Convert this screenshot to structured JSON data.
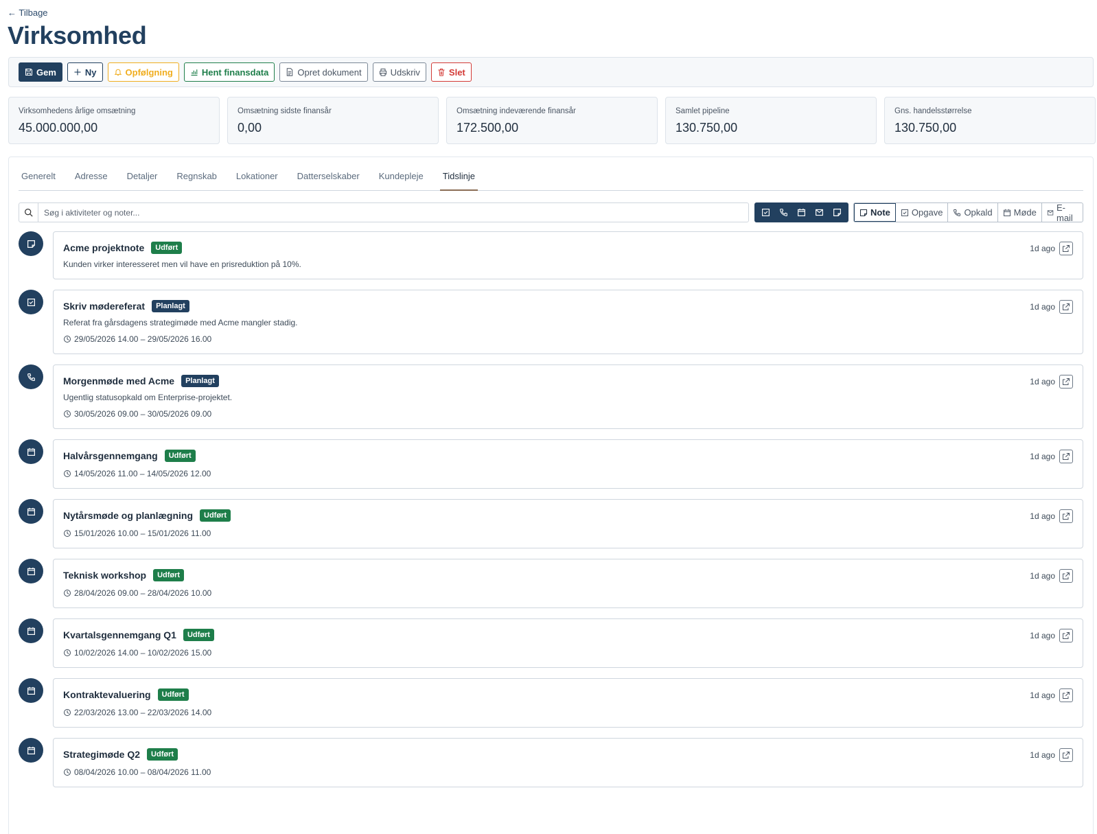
{
  "nav": {
    "back_label": "← Tilbage"
  },
  "page": {
    "title": "Virksomhed"
  },
  "toolbar": {
    "save": "Gem",
    "new": "Ny",
    "followup": "Opfølgning",
    "fetch_finance": "Hent finansdata",
    "create_doc": "Opret dokument",
    "print": "Udskriv",
    "delete": "Slet"
  },
  "stats": [
    {
      "label": "Virksomhedens årlige omsætning",
      "value": "45.000.000,00"
    },
    {
      "label": "Omsætning sidste finansår",
      "value": "0,00"
    },
    {
      "label": "Omsætning indeværende finansår",
      "value": "172.500,00"
    },
    {
      "label": "Samlet pipeline",
      "value": "130.750,00"
    },
    {
      "label": "Gns. handelsstørrelse",
      "value": "130.750,00"
    }
  ],
  "tabs": [
    "Generelt",
    "Adresse",
    "Detaljer",
    "Regnskab",
    "Lokationer",
    "Datterselskaber",
    "Kundepleje",
    "Tidslinje"
  ],
  "active_tab": "Tidslinje",
  "search": {
    "placeholder": "Søg i aktiviteter og noter..."
  },
  "filter_icons": [
    "task-icon",
    "phone-icon",
    "calendar-icon",
    "mail-icon",
    "note-icon"
  ],
  "new_buttons": [
    "Note",
    "Opgave",
    "Opkald",
    "Møde",
    "E-mail"
  ],
  "timeline": [
    {
      "type": "note",
      "title": "Acme projektnote",
      "status": "Udført",
      "status_kind": "done",
      "desc": "Kunden virker interesseret men vil have en prisreduktion på 10%.",
      "time": "",
      "ago": "1d ago"
    },
    {
      "type": "task",
      "title": "Skriv mødereferat",
      "status": "Planlagt",
      "status_kind": "planned",
      "desc": "Referat fra gårsdagens strategimøde med Acme mangler stadig.",
      "time": "29/05/2026 14.00 – 29/05/2026 16.00",
      "ago": "1d ago"
    },
    {
      "type": "call",
      "title": "Morgenmøde med Acme",
      "status": "Planlagt",
      "status_kind": "planned",
      "desc": "Ugentlig statusopkald om Enterprise-projektet.",
      "time": "30/05/2026 09.00 – 30/05/2026 09.00",
      "ago": "1d ago"
    },
    {
      "type": "meeting",
      "title": "Halvårsgennemgang",
      "status": "Udført",
      "status_kind": "done",
      "desc": "",
      "time": "14/05/2026 11.00 – 14/05/2026 12.00",
      "ago": "1d ago"
    },
    {
      "type": "meeting",
      "title": "Nytårsmøde og planlægning",
      "status": "Udført",
      "status_kind": "done",
      "desc": "",
      "time": "15/01/2026 10.00 – 15/01/2026 11.00",
      "ago": "1d ago"
    },
    {
      "type": "meeting",
      "title": "Teknisk workshop",
      "status": "Udført",
      "status_kind": "done",
      "desc": "",
      "time": "28/04/2026 09.00 – 28/04/2026 10.00",
      "ago": "1d ago"
    },
    {
      "type": "meeting",
      "title": "Kvartalsgennemgang Q1",
      "status": "Udført",
      "status_kind": "done",
      "desc": "",
      "time": "10/02/2026 14.00 – 10/02/2026 15.00",
      "ago": "1d ago"
    },
    {
      "type": "meeting",
      "title": "Kontraktevaluering",
      "status": "Udført",
      "status_kind": "done",
      "desc": "",
      "time": "22/03/2026 13.00 – 22/03/2026 14.00",
      "ago": "1d ago"
    },
    {
      "type": "meeting",
      "title": "Strategimøde Q2",
      "status": "Udført",
      "status_kind": "done",
      "desc": "",
      "time": "08/04/2026 10.00 – 08/04/2026 11.00",
      "ago": "1d ago"
    }
  ],
  "colors": {
    "primary": "#22405f",
    "success": "#1e7e4a",
    "warning": "#f0ad1e",
    "danger": "#d33a36",
    "tab_underline": "#8a6d55"
  }
}
